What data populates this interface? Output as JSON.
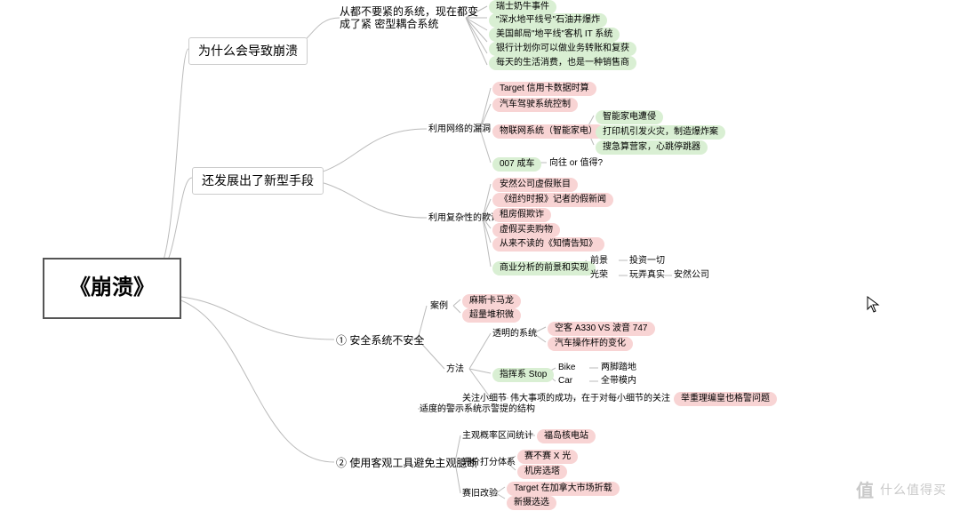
{
  "root": "《崩溃》",
  "b1_why": "为什么会导致崩溃",
  "b1_new": "还发展出了新型手段",
  "why_a_label": "从都不要紧的系统，现在都变成了紧\n密型耦合系统",
  "why_items": [
    "瑞士奶牛事件",
    "\"深水地平线号\"石油井爆炸",
    "美国邮局\"地平线\"客机 IT 系统",
    "银行计划你可以做业务转账和复获",
    "每天的生活消费，也是一种销售商"
  ],
  "net_label": "利用网络的漏洞",
  "net_items": [
    "Target 信用卡数据时算",
    "汽车驾驶系统控制"
  ],
  "iot_label": "物联网系统（智能家电）",
  "iot_items": [
    "智能家电遭侵",
    "打印机引发火灾，制造爆炸案",
    "搜急算营家，心跳停跳器"
  ],
  "oo7": "007 成车",
  "oo7_leaf": "向往 or 值得?",
  "fraud_label": "利用复杂性的欺诈",
  "fraud_items": [
    "安然公司虚假账目",
    "《纽约时报》记者的假新闻",
    "租房假欺诈",
    "虚假买卖购物",
    "从来不读的《知情告知》"
  ],
  "biz_label": "商业分析的前景和实现",
  "biz_cols": [
    "前景",
    "光荣"
  ],
  "biz_leaves": [
    "投资一切",
    "玩弄真实"
  ],
  "biz_leaf3": "安然公司",
  "sec_label": "① 安全系统不安全",
  "sec_case": "案例",
  "sec_case_items": [
    "麻斯卡马龙",
    "超量堆积微"
  ],
  "sec_method": "方法",
  "sec_trans": "透明的系统",
  "sec_trans_items": [
    "空客 A330 VS 波音 747",
    "汽车操作杆的变化"
  ],
  "sec_stop": "指挥系 Stop",
  "sec_stop_rows": [
    "Bike",
    "Car"
  ],
  "sec_stop_leaves": [
    "两脚踏地",
    "全带模内"
  ],
  "sec_detail": "关注小细节",
  "sec_detail_leaf": "伟大事项的成功，在于对每小细节的关注",
  "sec_detail_red": "举重理编皇也格警问题",
  "sec_warn": "适度的警示系统",
  "sec_warn_leaf": "示警提的结构",
  "obj_label": "② 使用客观工具避免主观臆断",
  "obj_freq": "主观概率区间统计",
  "obj_freq_leaf": "福岛核电站",
  "obj_rating": "评价打分体系",
  "obj_rating_items": [
    "赛不赛 X 光",
    "机房选塔"
  ],
  "obj_retro": "赛旧改验",
  "obj_retro_items": [
    "Target 在加拿大市场折载",
    "新摄选选"
  ],
  "cursor_glyph": "↖",
  "watermark_text": "什么值得买"
}
